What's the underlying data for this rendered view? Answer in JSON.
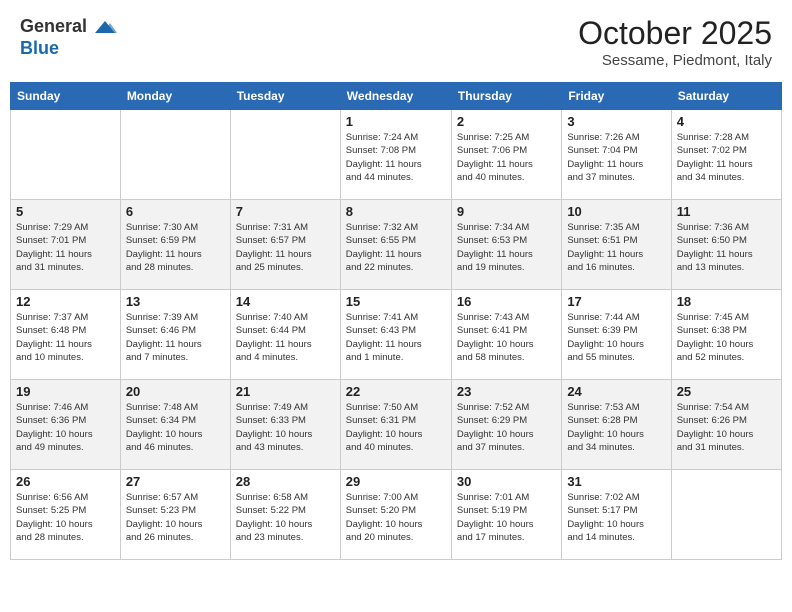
{
  "header": {
    "logo_line1": "General",
    "logo_line2": "Blue",
    "month_title": "October 2025",
    "subtitle": "Sessame, Piedmont, Italy"
  },
  "days_of_week": [
    "Sunday",
    "Monday",
    "Tuesday",
    "Wednesday",
    "Thursday",
    "Friday",
    "Saturday"
  ],
  "weeks": [
    [
      {
        "day": "",
        "info": ""
      },
      {
        "day": "",
        "info": ""
      },
      {
        "day": "",
        "info": ""
      },
      {
        "day": "1",
        "info": "Sunrise: 7:24 AM\nSunset: 7:08 PM\nDaylight: 11 hours\nand 44 minutes."
      },
      {
        "day": "2",
        "info": "Sunrise: 7:25 AM\nSunset: 7:06 PM\nDaylight: 11 hours\nand 40 minutes."
      },
      {
        "day": "3",
        "info": "Sunrise: 7:26 AM\nSunset: 7:04 PM\nDaylight: 11 hours\nand 37 minutes."
      },
      {
        "day": "4",
        "info": "Sunrise: 7:28 AM\nSunset: 7:02 PM\nDaylight: 11 hours\nand 34 minutes."
      }
    ],
    [
      {
        "day": "5",
        "info": "Sunrise: 7:29 AM\nSunset: 7:01 PM\nDaylight: 11 hours\nand 31 minutes."
      },
      {
        "day": "6",
        "info": "Sunrise: 7:30 AM\nSunset: 6:59 PM\nDaylight: 11 hours\nand 28 minutes."
      },
      {
        "day": "7",
        "info": "Sunrise: 7:31 AM\nSunset: 6:57 PM\nDaylight: 11 hours\nand 25 minutes."
      },
      {
        "day": "8",
        "info": "Sunrise: 7:32 AM\nSunset: 6:55 PM\nDaylight: 11 hours\nand 22 minutes."
      },
      {
        "day": "9",
        "info": "Sunrise: 7:34 AM\nSunset: 6:53 PM\nDaylight: 11 hours\nand 19 minutes."
      },
      {
        "day": "10",
        "info": "Sunrise: 7:35 AM\nSunset: 6:51 PM\nDaylight: 11 hours\nand 16 minutes."
      },
      {
        "day": "11",
        "info": "Sunrise: 7:36 AM\nSunset: 6:50 PM\nDaylight: 11 hours\nand 13 minutes."
      }
    ],
    [
      {
        "day": "12",
        "info": "Sunrise: 7:37 AM\nSunset: 6:48 PM\nDaylight: 11 hours\nand 10 minutes."
      },
      {
        "day": "13",
        "info": "Sunrise: 7:39 AM\nSunset: 6:46 PM\nDaylight: 11 hours\nand 7 minutes."
      },
      {
        "day": "14",
        "info": "Sunrise: 7:40 AM\nSunset: 6:44 PM\nDaylight: 11 hours\nand 4 minutes."
      },
      {
        "day": "15",
        "info": "Sunrise: 7:41 AM\nSunset: 6:43 PM\nDaylight: 11 hours\nand 1 minute."
      },
      {
        "day": "16",
        "info": "Sunrise: 7:43 AM\nSunset: 6:41 PM\nDaylight: 10 hours\nand 58 minutes."
      },
      {
        "day": "17",
        "info": "Sunrise: 7:44 AM\nSunset: 6:39 PM\nDaylight: 10 hours\nand 55 minutes."
      },
      {
        "day": "18",
        "info": "Sunrise: 7:45 AM\nSunset: 6:38 PM\nDaylight: 10 hours\nand 52 minutes."
      }
    ],
    [
      {
        "day": "19",
        "info": "Sunrise: 7:46 AM\nSunset: 6:36 PM\nDaylight: 10 hours\nand 49 minutes."
      },
      {
        "day": "20",
        "info": "Sunrise: 7:48 AM\nSunset: 6:34 PM\nDaylight: 10 hours\nand 46 minutes."
      },
      {
        "day": "21",
        "info": "Sunrise: 7:49 AM\nSunset: 6:33 PM\nDaylight: 10 hours\nand 43 minutes."
      },
      {
        "day": "22",
        "info": "Sunrise: 7:50 AM\nSunset: 6:31 PM\nDaylight: 10 hours\nand 40 minutes."
      },
      {
        "day": "23",
        "info": "Sunrise: 7:52 AM\nSunset: 6:29 PM\nDaylight: 10 hours\nand 37 minutes."
      },
      {
        "day": "24",
        "info": "Sunrise: 7:53 AM\nSunset: 6:28 PM\nDaylight: 10 hours\nand 34 minutes."
      },
      {
        "day": "25",
        "info": "Sunrise: 7:54 AM\nSunset: 6:26 PM\nDaylight: 10 hours\nand 31 minutes."
      }
    ],
    [
      {
        "day": "26",
        "info": "Sunrise: 6:56 AM\nSunset: 5:25 PM\nDaylight: 10 hours\nand 28 minutes."
      },
      {
        "day": "27",
        "info": "Sunrise: 6:57 AM\nSunset: 5:23 PM\nDaylight: 10 hours\nand 26 minutes."
      },
      {
        "day": "28",
        "info": "Sunrise: 6:58 AM\nSunset: 5:22 PM\nDaylight: 10 hours\nand 23 minutes."
      },
      {
        "day": "29",
        "info": "Sunrise: 7:00 AM\nSunset: 5:20 PM\nDaylight: 10 hours\nand 20 minutes."
      },
      {
        "day": "30",
        "info": "Sunrise: 7:01 AM\nSunset: 5:19 PM\nDaylight: 10 hours\nand 17 minutes."
      },
      {
        "day": "31",
        "info": "Sunrise: 7:02 AM\nSunset: 5:17 PM\nDaylight: 10 hours\nand 14 minutes."
      },
      {
        "day": "",
        "info": ""
      }
    ]
  ]
}
